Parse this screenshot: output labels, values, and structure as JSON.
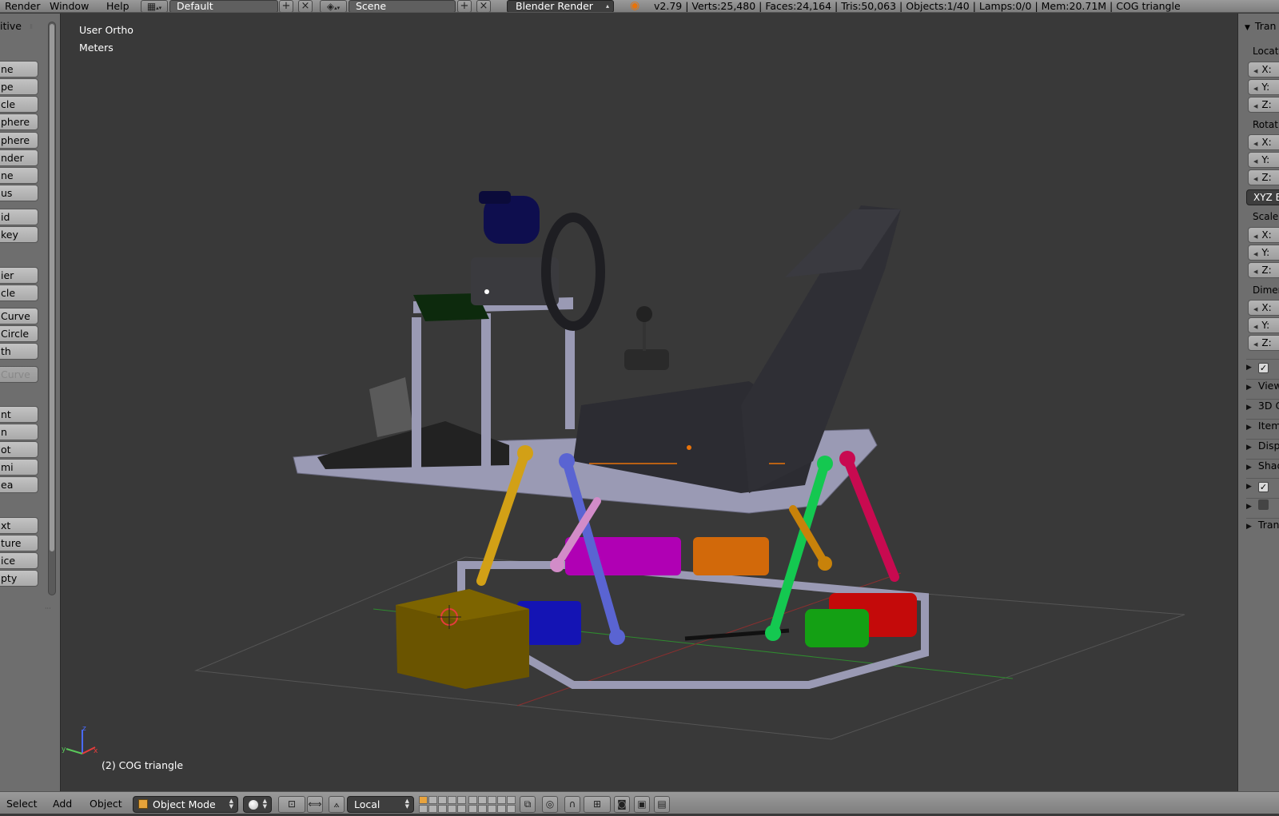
{
  "top_header": {
    "menus": [
      "Render",
      "Window",
      "Help"
    ],
    "layout_name": "Default",
    "scene_name": "Scene",
    "render_engine": "Blender Render",
    "stats": "v2.79 | Verts:25,480 | Faces:24,164 | Tris:50,063 | Objects:1/40 | Lamps:0/0 | Mem:20.71M | COG triangle"
  },
  "tool_shelf": {
    "panel_title": "itive",
    "buttons": [
      "ne",
      "pe",
      "cle",
      "phere",
      "phere",
      "nder",
      "ne",
      "us",
      "id",
      "key",
      "ier",
      "cle",
      "Curve",
      "Circle",
      "th",
      "Curve",
      "nt",
      "n",
      "ot",
      "mi",
      "ea",
      "xt",
      "ture",
      "ice",
      "pty"
    ]
  },
  "viewport": {
    "view_name": "User Ortho",
    "units": "Meters",
    "active_object": "(2) COG triangle",
    "axis_labels": {
      "x": "x",
      "y": "y",
      "z": "z"
    }
  },
  "properties_panel": {
    "header": "Tran",
    "location_label": "Locat",
    "rotation_label": "Rotati",
    "scale_label": "Scale",
    "dimensions_label": "Dimen",
    "axis_x": "X:",
    "axis_y": "Y:",
    "axis_z": "Z:",
    "rotation_mode": "XYZ E",
    "collapsed_panels": [
      "",
      "View",
      "3D C",
      "Item",
      "Disp",
      "Shad",
      "",
      "",
      "Tran"
    ]
  },
  "bottom_header": {
    "menus": [
      "Select",
      "Add",
      "Object"
    ],
    "mode": "Object Mode",
    "orientation": "Local"
  },
  "colors": {
    "viewport_bg": "#393939",
    "panel_bg": "#6e6e6e",
    "accent_orange": "#e8730a"
  }
}
